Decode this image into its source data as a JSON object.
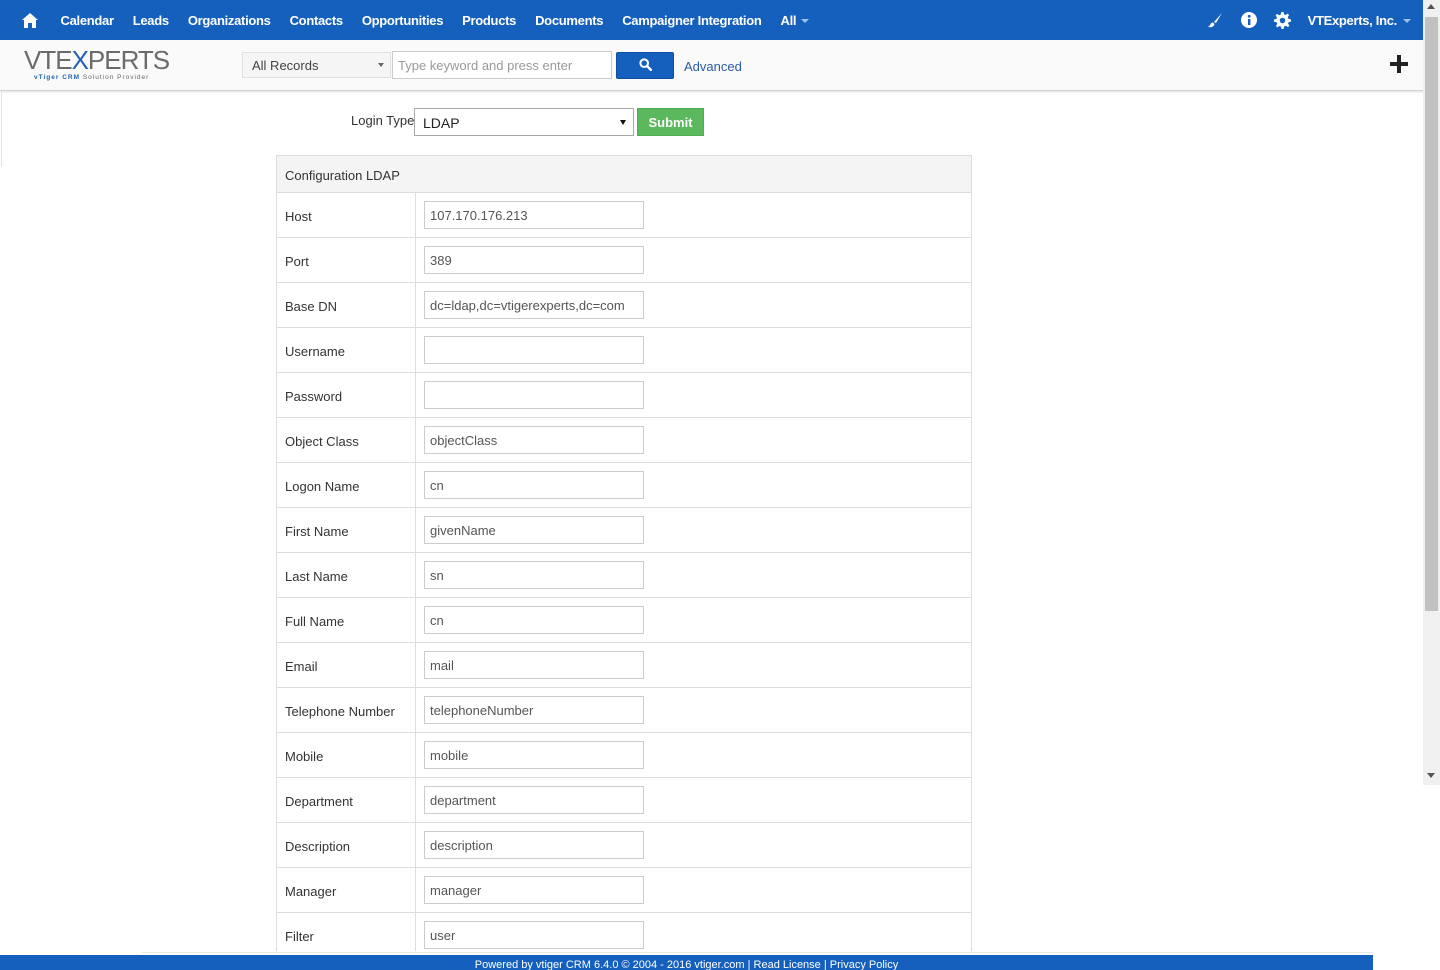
{
  "nav": {
    "items": [
      {
        "label": "Calendar"
      },
      {
        "label": "Leads"
      },
      {
        "label": "Organizations"
      },
      {
        "label": "Contacts"
      },
      {
        "label": "Opportunities"
      },
      {
        "label": "Products"
      },
      {
        "label": "Documents"
      },
      {
        "label": "Campaigner Integration"
      }
    ],
    "all_label": "All",
    "user_label": "VTExperts, Inc.",
    "colors": {
      "bar": "#1560bd"
    }
  },
  "logo": {
    "brand_pre": "VTE",
    "brand_x": "X",
    "brand_post": "PERTS",
    "tag_a": "vTiger",
    "tag_b": "CRM",
    "tag_c": "Solution Provider"
  },
  "search": {
    "scope": "All Records",
    "placeholder": "Type keyword and press enter",
    "advanced_label": "Advanced"
  },
  "login": {
    "label": "Login Type",
    "selected": "LDAP",
    "submit_label": "Submit"
  },
  "config": {
    "title": "Configuration LDAP",
    "rows": [
      {
        "label": "Host",
        "value": "107.170.176.213"
      },
      {
        "label": "Port",
        "value": "389"
      },
      {
        "label": "Base DN",
        "value": "dc=ldap,dc=vtigerexperts,dc=com"
      },
      {
        "label": "Username",
        "value": ""
      },
      {
        "label": "Password",
        "value": ""
      },
      {
        "label": "Object Class",
        "value": "objectClass"
      },
      {
        "label": "Logon Name",
        "value": "cn"
      },
      {
        "label": "First Name",
        "value": "givenName"
      },
      {
        "label": "Last Name",
        "value": "sn"
      },
      {
        "label": "Full Name",
        "value": "cn"
      },
      {
        "label": "Email",
        "value": "mail"
      },
      {
        "label": "Telephone Number",
        "value": "telephoneNumber"
      },
      {
        "label": "Mobile",
        "value": "mobile"
      },
      {
        "label": "Department",
        "value": "department"
      },
      {
        "label": "Description",
        "value": "description"
      },
      {
        "label": "Manager",
        "value": "manager"
      },
      {
        "label": "Filter",
        "value": "user"
      }
    ]
  },
  "footer": {
    "text": "Powered by vtiger CRM 6.4.0  © 2004 - 2016  vtiger.com | Read License | Privacy Policy"
  }
}
